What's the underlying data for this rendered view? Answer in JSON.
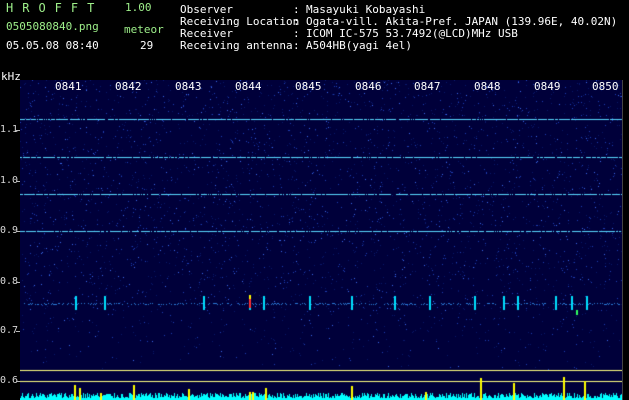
{
  "header": {
    "brand": "HROFFT",
    "version": "1.00",
    "filename": "0505080840.png",
    "meteor_label": "meteor",
    "datetime": "05.05.08 08:40",
    "meteor_count": "29"
  },
  "info": [
    {
      "label": "Observer",
      "value": "Masayuki Kobayashi"
    },
    {
      "label": "Receiving Location",
      "value": "Ogata-vill. Akita-Pref. JAPAN (139.96E, 40.02N)"
    },
    {
      "label": "Receiver",
      "value": "ICOM IC-575 53.7492(@LCD)MHz USB"
    },
    {
      "label": "Receiving antenna",
      "value": "A504HB(yagi 4el)"
    }
  ],
  "colon": ":",
  "axis": {
    "unit": "kHz",
    "freq_labels": [
      "1.1",
      "1.0",
      "0.9",
      "0.8",
      "0.7",
      "0.6"
    ],
    "time_labels": [
      "0841",
      "0842",
      "0843",
      "0844",
      "0845",
      "0846",
      "0847",
      "0848",
      "0849",
      "0850"
    ]
  },
  "colors": {
    "background": "#00003a",
    "noise_dark": "#0a1a6a",
    "noise_light": "#3c6cf0",
    "carrier": "#59d9ff",
    "trace_line": "#ffff80",
    "bars": "#ffff00",
    "baseline": "#00ffff"
  }
}
